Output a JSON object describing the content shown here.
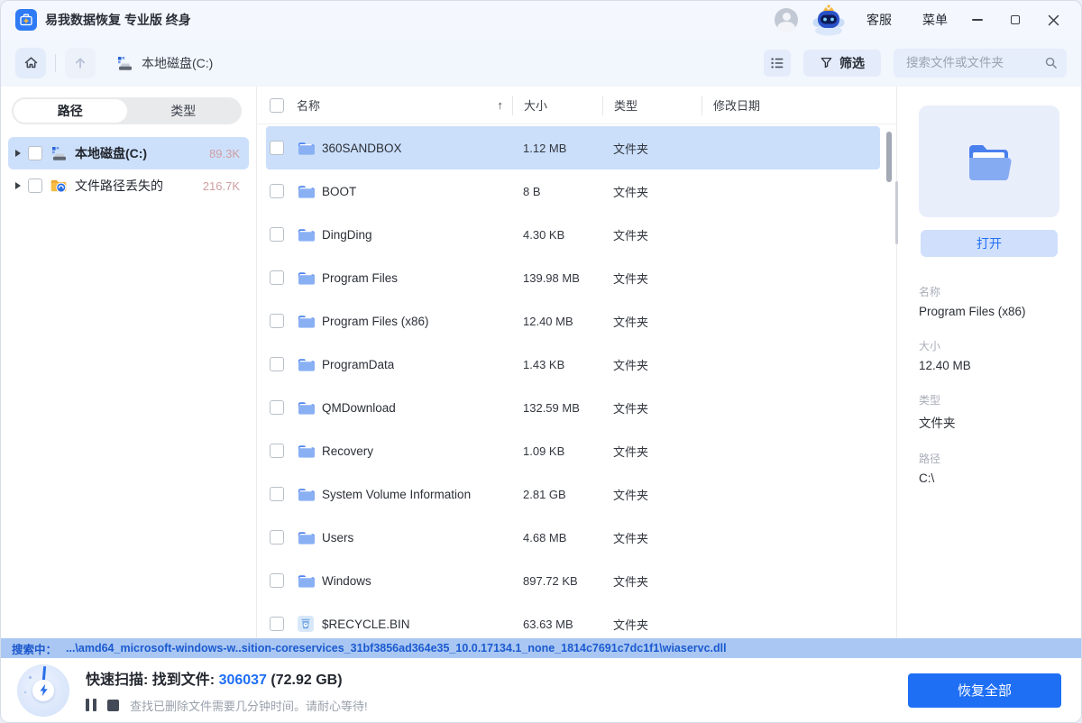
{
  "window": {
    "title": "易我数据恢复 专业版 终身",
    "links": {
      "customer_service": "客服",
      "menu": "菜单"
    }
  },
  "toolbar": {
    "breadcrumb": "本地磁盘(C:)",
    "filter_label": "筛选",
    "search_placeholder": "搜索文件或文件夹"
  },
  "sidebar": {
    "tabs": [
      {
        "label": "路径",
        "active": true
      },
      {
        "label": "类型",
        "active": false
      }
    ],
    "items": [
      {
        "label": "本地磁盘(C:)",
        "count": "89.3K",
        "selected": true,
        "icon": "drive-icon"
      },
      {
        "label": "文件路径丢失的",
        "count": "216.7K",
        "selected": false,
        "icon": "lost-folder-icon"
      }
    ]
  },
  "table": {
    "columns": {
      "name": "名称",
      "size": "大小",
      "type": "类型",
      "modified": "修改日期"
    },
    "sort_asc": "↑",
    "rows": [
      {
        "name": "360SANDBOX",
        "size": "1.12 MB",
        "type": "文件夹",
        "selected": true,
        "icon": "folder-icon"
      },
      {
        "name": "BOOT",
        "size": "8 B",
        "type": "文件夹",
        "selected": false,
        "icon": "folder-icon"
      },
      {
        "name": "DingDing",
        "size": "4.30 KB",
        "type": "文件夹",
        "selected": false,
        "icon": "folder-icon"
      },
      {
        "name": "Program Files",
        "size": "139.98 MB",
        "type": "文件夹",
        "selected": false,
        "icon": "folder-icon"
      },
      {
        "name": "Program Files (x86)",
        "size": "12.40 MB",
        "type": "文件夹",
        "selected": false,
        "icon": "folder-icon"
      },
      {
        "name": "ProgramData",
        "size": "1.43 KB",
        "type": "文件夹",
        "selected": false,
        "icon": "folder-icon"
      },
      {
        "name": "QMDownload",
        "size": "132.59 MB",
        "type": "文件夹",
        "selected": false,
        "icon": "folder-icon"
      },
      {
        "name": "Recovery",
        "size": "1.09 KB",
        "type": "文件夹",
        "selected": false,
        "icon": "folder-icon"
      },
      {
        "name": "System Volume Information",
        "size": "2.81 GB",
        "type": "文件夹",
        "selected": false,
        "icon": "folder-icon"
      },
      {
        "name": "Users",
        "size": "4.68 MB",
        "type": "文件夹",
        "selected": false,
        "icon": "folder-icon"
      },
      {
        "name": "Windows",
        "size": "897.72 KB",
        "type": "文件夹",
        "selected": false,
        "icon": "folder-icon"
      },
      {
        "name": "$RECYCLE.BIN",
        "size": "63.63 MB",
        "type": "文件夹",
        "selected": false,
        "icon": "recycle-bin-icon"
      }
    ]
  },
  "details": {
    "open_button": "打开",
    "fields": [
      {
        "label": "名称",
        "value": "Program Files (x86)"
      },
      {
        "label": "大小",
        "value": "12.40 MB"
      },
      {
        "label": "类型",
        "value": "文件夹"
      },
      {
        "label": "路径",
        "value": "C:\\"
      }
    ]
  },
  "statusbar": {
    "label": "搜索中：",
    "path": "...\\amd64_microsoft-windows-w..sition-coreservices_31bf3856ad364e35_10.0.17134.1_none_1814c7691c7dc1f1\\wiaservc.dll"
  },
  "footer": {
    "scan_prefix": "快速扫描: 找到文件: ",
    "found_count": "306037",
    "found_size": " (72.92 GB)",
    "hint": "查找已删除文件需要几分钟时间。请耐心等待!",
    "recover_button": "恢复全部"
  },
  "colors": {
    "accent_blue": "#1f6ff5",
    "selection_blue": "#cbdffb",
    "statusbar_blue": "#a9c7f2",
    "count_red": "#cf9fa2",
    "folder_front": "#8ab0f4",
    "folder_back": "#4f83ef"
  }
}
